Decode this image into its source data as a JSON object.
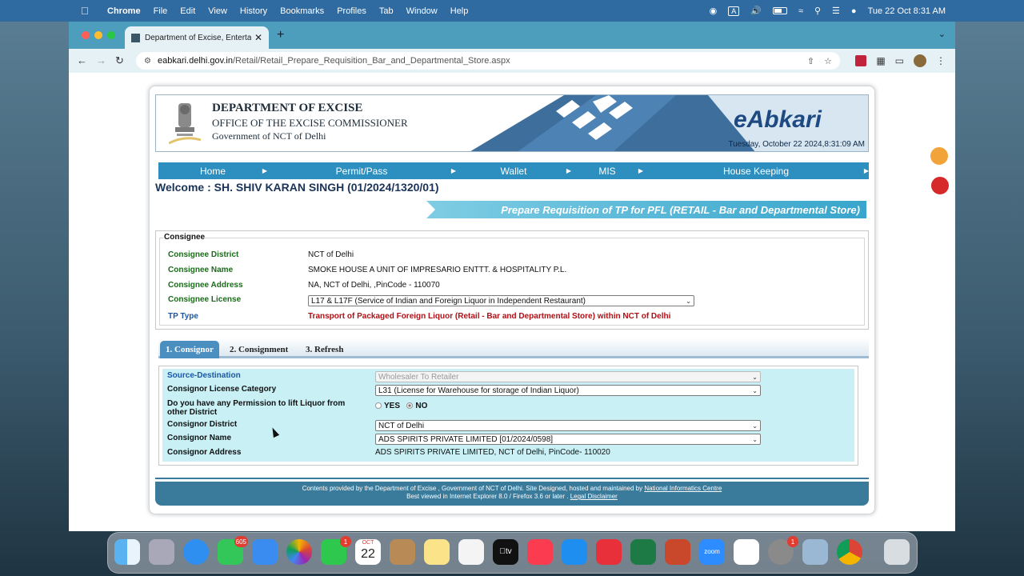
{
  "menubar": {
    "app": "Chrome",
    "items": [
      "File",
      "Edit",
      "View",
      "History",
      "Bookmarks",
      "Profiles",
      "Tab",
      "Window",
      "Help"
    ],
    "input_indicator": "A",
    "clock": "Tue 22 Oct  8:31 AM"
  },
  "browser": {
    "tab_title": "Department of Excise, Enterta",
    "url_host": "eabkari.delhi.gov.in",
    "url_path": "/Retail/Retail_Prepare_Requisition_Bar_and_Departmental_Store.aspx"
  },
  "header": {
    "dept": "DEPARTMENT OF EXCISE",
    "office": "OFFICE OF THE EXCISE COMMISSIONER",
    "govt": "Government of NCT of Delhi",
    "brand": "eAbkari",
    "datetime": "Tuesday, October 22 2024,8:31:09 AM"
  },
  "nav": {
    "items": [
      "Home",
      "Permit/Pass",
      "Wallet",
      "MIS",
      "House Keeping"
    ]
  },
  "welcome": "Welcome : SH. SHIV KARAN SINGH (01/2024/1320/01)",
  "page_title": "Prepare Requisition of TP for PFL (RETAIL - Bar and Departmental Store)",
  "consignee": {
    "legend": "Consignee",
    "rows": [
      {
        "label": "Consignee District",
        "value": "NCT of Delhi"
      },
      {
        "label": "Consignee Name",
        "value": "SMOKE HOUSE A UNIT OF IMPRESARIO ENTTT. & HOSPITALITY P.L."
      },
      {
        "label": "Consignee Address",
        "value": "NA, NCT of Delhi, ,PinCode - 110070"
      },
      {
        "label": "Consignee License",
        "value": "L17 & L17F (Service of Indian and Foreign Liquor in Independent Restaurant)"
      },
      {
        "label": "TP Type",
        "value": "Transport of Packaged Foreign Liquor (Retail - Bar and Departmental Store) within NCT of Delhi"
      }
    ]
  },
  "tabs": [
    "1. Consignor",
    "2. Consignment",
    "3. Refresh"
  ],
  "consignor": {
    "source_destination": {
      "label": "Source-Destination",
      "value": "Wholesaler To Retailer"
    },
    "license_category": {
      "label": "Consignor License Category",
      "value": "L31 (License for Warehouse for storage of Indian Liquor)"
    },
    "permission": {
      "label": "Do you have any Permission to lift Liquor from other District",
      "yes": "YES",
      "no": "NO"
    },
    "district": {
      "label": "Consignor District",
      "value": "NCT of Delhi"
    },
    "name": {
      "label": "Consignor Name",
      "value": "ADS SPIRITS PRIVATE LIMITED [01/2024/0598]"
    },
    "address": {
      "label": "Consignor Address",
      "value": "ADS SPIRITS PRIVATE LIMITED, NCT of Delhi, PinCode- 110020"
    }
  },
  "footer": {
    "line1_text": "Contents provided by the Department of Excise , Government of NCT of Delhi. Site Designed, hosted and maintained by",
    "line1_link": "National Informatics Centre",
    "line2_text": "Best viewed in Internet Explorer 8.0 / Firefox 3.6 or later .",
    "line2_link": "Legal Disclaimer"
  },
  "dock": {
    "messages_badge": "605",
    "facetime_badge": "1",
    "calendar_month": "OCT",
    "calendar_day": "22",
    "settings_badge": "1",
    "zoom_label": "zoom"
  }
}
